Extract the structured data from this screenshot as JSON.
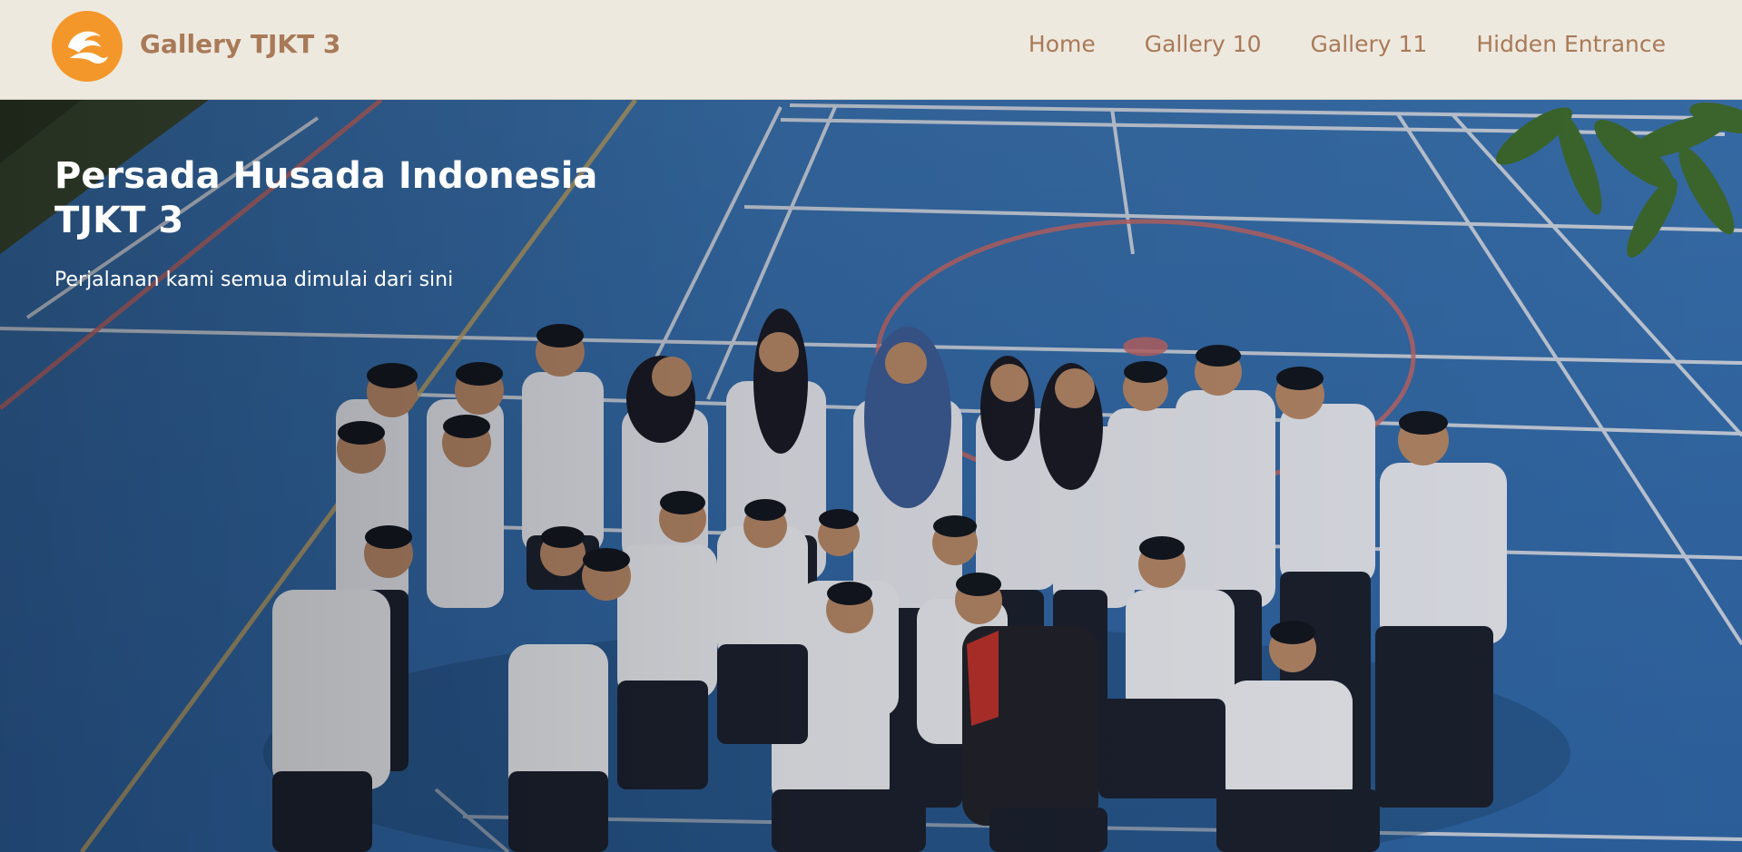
{
  "header": {
    "brand": "Gallery TJKT 3",
    "logo_icon": "wave-logo-icon",
    "nav": [
      {
        "label": "Home"
      },
      {
        "label": "Gallery 10"
      },
      {
        "label": "Gallery 11"
      },
      {
        "label": "Hidden Entrance"
      }
    ]
  },
  "hero": {
    "title_line1": "Persada Husada Indonesia",
    "title_line2": "TJKT 3",
    "subtitle": "Perjalanan kami semua dimulai dari sini",
    "image_description": "group-photo-students-on-blue-court"
  },
  "colors": {
    "header_bg": "#eee9df",
    "accent": "#f4972a",
    "nav_text": "#a97a58",
    "court_blue": "#3e76b4",
    "hero_text": "#ffffff"
  }
}
